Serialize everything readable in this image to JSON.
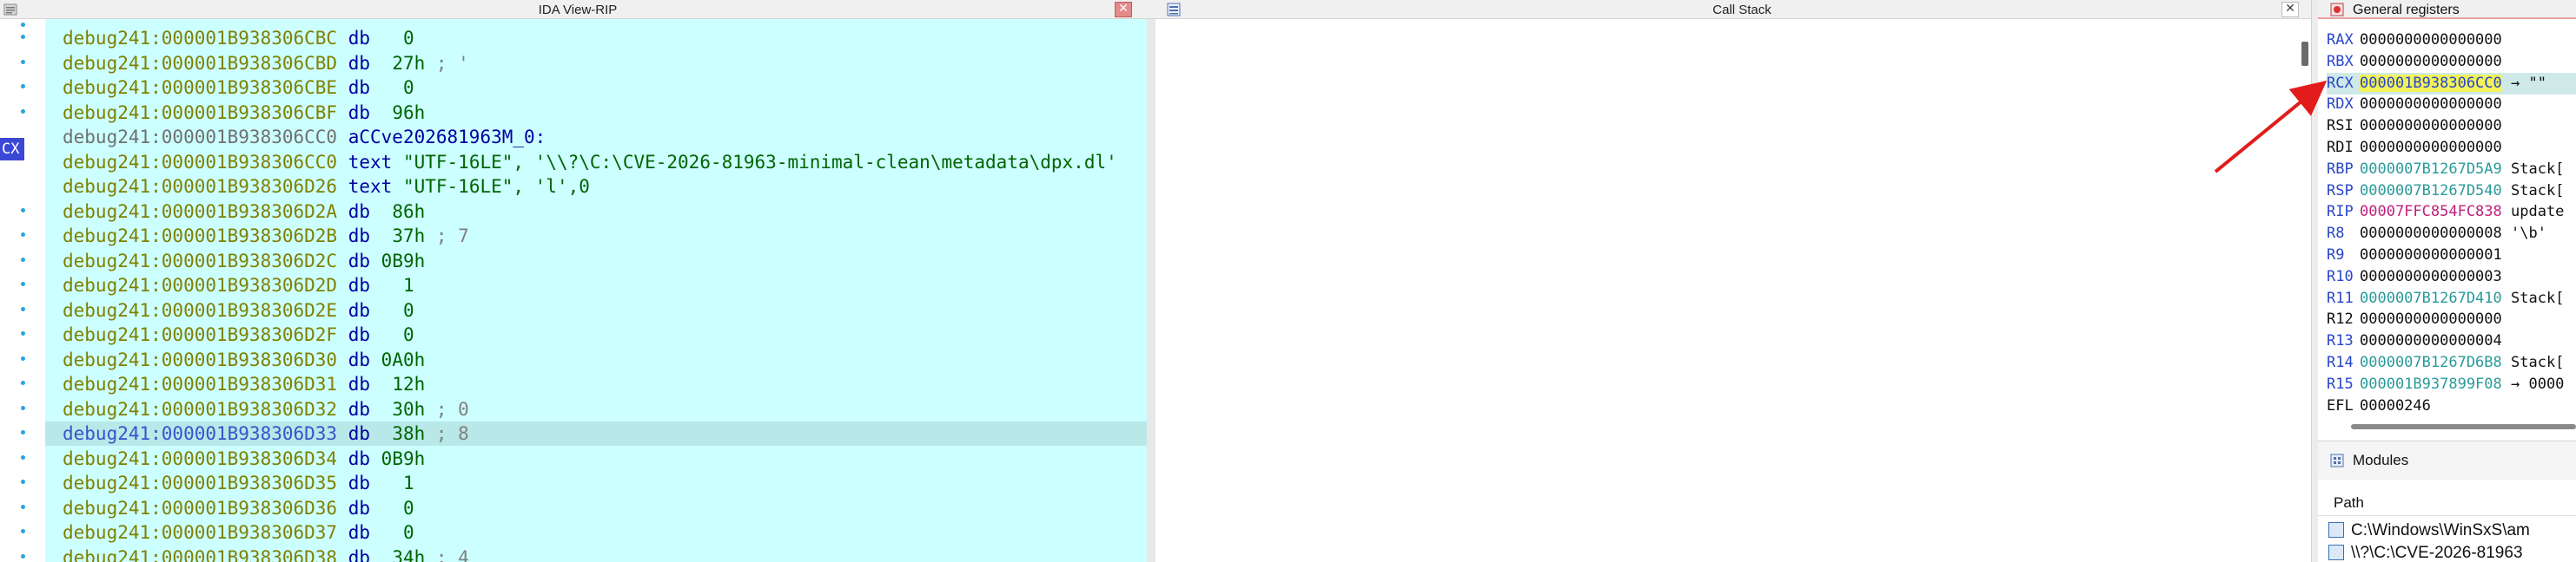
{
  "ida_view": {
    "title": "IDA View-RIP",
    "close_glyph": "✕",
    "register_tag": "CX",
    "lines": [
      {
        "addr": "debug241:000001B938306CBC",
        "op": "db",
        "arg": "   0",
        "comment": "",
        "style": "normal"
      },
      {
        "addr": "debug241:000001B938306CBD",
        "op": "db",
        "arg": "  27h",
        "comment": " ; '",
        "style": "normal"
      },
      {
        "addr": "debug241:000001B938306CBE",
        "op": "db",
        "arg": "   0",
        "comment": "",
        "style": "normal"
      },
      {
        "addr": "debug241:000001B938306CBF",
        "op": "db",
        "arg": "  96h",
        "comment": "",
        "style": "normal"
      },
      {
        "addr": "debug241:000001B938306CC0",
        "op": "aCCve202681963M_0:",
        "arg": "",
        "comment": "",
        "style": "label"
      },
      {
        "addr": "debug241:000001B938306CC0",
        "op": "text",
        "arg": " \"UTF-16LE\", '\\\\?\\C:\\CVE-2026-81963-minimal-clean\\metadata\\dpx.dl'",
        "comment": "",
        "style": "string"
      },
      {
        "addr": "debug241:000001B938306D26",
        "op": "text",
        "arg": " \"UTF-16LE\", 'l',0",
        "comment": "",
        "style": "string"
      },
      {
        "addr": "debug241:000001B938306D2A",
        "op": "db",
        "arg": "  86h",
        "comment": "",
        "style": "normal"
      },
      {
        "addr": "debug241:000001B938306D2B",
        "op": "db",
        "arg": "  37h",
        "comment": " ; 7",
        "style": "normal"
      },
      {
        "addr": "debug241:000001B938306D2C",
        "op": "db",
        "arg": " 0B9h",
        "comment": "",
        "style": "normal"
      },
      {
        "addr": "debug241:000001B938306D2D",
        "op": "db",
        "arg": "   1",
        "comment": "",
        "style": "normal"
      },
      {
        "addr": "debug241:000001B938306D2E",
        "op": "db",
        "arg": "   0",
        "comment": "",
        "style": "normal"
      },
      {
        "addr": "debug241:000001B938306D2F",
        "op": "db",
        "arg": "   0",
        "comment": "",
        "style": "normal"
      },
      {
        "addr": "debug241:000001B938306D30",
        "op": "db",
        "arg": " 0A0h",
        "comment": "",
        "style": "normal"
      },
      {
        "addr": "debug241:000001B938306D31",
        "op": "db",
        "arg": "  12h",
        "comment": "",
        "style": "normal"
      },
      {
        "addr": "debug241:000001B938306D32",
        "op": "db",
        "arg": "  30h",
        "comment": " ; 0",
        "style": "normal"
      },
      {
        "addr": "debug241:000001B938306D33",
        "op": "db",
        "arg": "  38h",
        "comment": " ; 8",
        "style": "current"
      },
      {
        "addr": "debug241:000001B938306D34",
        "op": "db",
        "arg": " 0B9h",
        "comment": "",
        "style": "normal"
      },
      {
        "addr": "debug241:000001B938306D35",
        "op": "db",
        "arg": "   1",
        "comment": "",
        "style": "normal"
      },
      {
        "addr": "debug241:000001B938306D36",
        "op": "db",
        "arg": "   0",
        "comment": "",
        "style": "normal"
      },
      {
        "addr": "debug241:000001B938306D37",
        "op": "db",
        "arg": "   0",
        "comment": "",
        "style": "normal"
      },
      {
        "addr": "debug241:000001B938306D38",
        "op": "db",
        "arg": "  34h",
        "comment": " ; 4",
        "style": "normal"
      }
    ]
  },
  "call_stack": {
    "title": "Call Stack",
    "close_glyph": "✕"
  },
  "registers": {
    "title": "General registers",
    "rows": [
      {
        "name": "RAX",
        "value": "0000000000000000",
        "hint": "",
        "name_style": "chg",
        "value_style": "plain"
      },
      {
        "name": "RBX",
        "value": "0000000000000000",
        "hint": "",
        "name_style": "chg",
        "value_style": "plain"
      },
      {
        "name": "RCX",
        "value": "000001B938306CC0",
        "hint": " → \"\"",
        "name_style": "chg",
        "value_style": "sel"
      },
      {
        "name": "RDX",
        "value": "0000000000000000",
        "hint": "",
        "name_style": "chg",
        "value_style": "plain"
      },
      {
        "name": "RSI",
        "value": "0000000000000000",
        "hint": "",
        "name_style": "same",
        "value_style": "plain"
      },
      {
        "name": "RDI",
        "value": "0000000000000000",
        "hint": "",
        "name_style": "same",
        "value_style": "plain"
      },
      {
        "name": "RBP",
        "value": "0000007B1267D5A9",
        "hint": " Stack[",
        "name_style": "chg",
        "value_style": "stack"
      },
      {
        "name": "RSP",
        "value": "0000007B1267D540",
        "hint": " Stack[",
        "name_style": "chg",
        "value_style": "stack"
      },
      {
        "name": "RIP",
        "value": "00007FFC854FC838",
        "hint": " update",
        "name_style": "chg",
        "value_style": "code"
      },
      {
        "name": "R8",
        "value": "0000000000000008",
        "hint": " '\\b'",
        "name_style": "chg",
        "value_style": "plain"
      },
      {
        "name": "R9",
        "value": "0000000000000001",
        "hint": "",
        "name_style": "chg",
        "value_style": "plain"
      },
      {
        "name": "R10",
        "value": "0000000000000003",
        "hint": "",
        "name_style": "chg",
        "value_style": "plain"
      },
      {
        "name": "R11",
        "value": "0000007B1267D410",
        "hint": " Stack[",
        "name_style": "chg",
        "value_style": "stack"
      },
      {
        "name": "R12",
        "value": "0000000000000000",
        "hint": "",
        "name_style": "same",
        "value_style": "plain"
      },
      {
        "name": "R13",
        "value": "0000000000000004",
        "hint": "",
        "name_style": "chg",
        "value_style": "plain"
      },
      {
        "name": "R14",
        "value": "0000007B1267D6B8",
        "hint": " Stack[",
        "name_style": "chg",
        "value_style": "stack"
      },
      {
        "name": "R15",
        "value": "000001B937899F08",
        "hint": " → 0000",
        "name_style": "chg",
        "value_style": "stack"
      },
      {
        "name": "EFL",
        "value": "00000246",
        "hint": "",
        "name_style": "same",
        "value_style": "plain"
      }
    ]
  },
  "modules": {
    "title": "Modules",
    "column_path": "Path",
    "rows": [
      {
        "path": "C:\\Windows\\WinSxS\\am"
      },
      {
        "path": "\\\\?\\C:\\CVE-2026-81963"
      }
    ]
  },
  "colors": {
    "code_bg": "#ccffff",
    "current_line_bg": "#b8e8e8",
    "arrow": "#e21b1b"
  }
}
